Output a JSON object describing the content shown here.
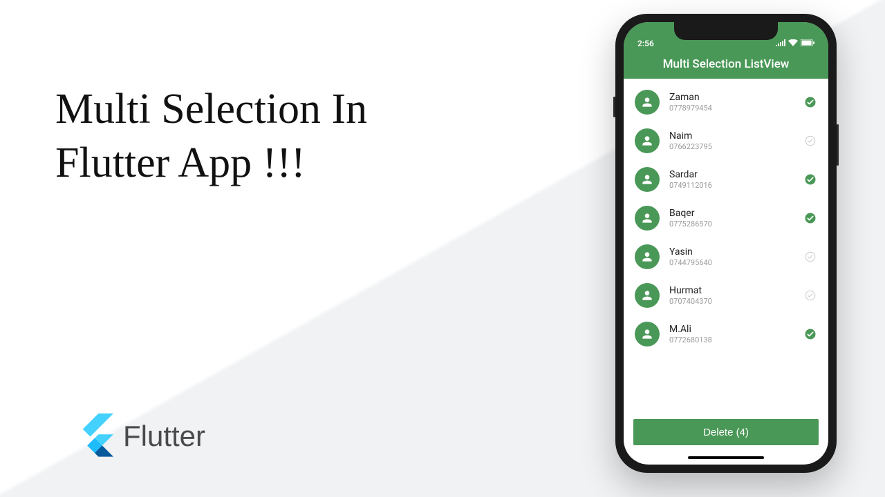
{
  "headline": "Multi Selection In\nFlutter App !!!",
  "brand": "Flutter",
  "statusBar": {
    "time": "2:56"
  },
  "appBar": {
    "title": "Multi Selection ListView"
  },
  "contacts": [
    {
      "name": "Zaman",
      "phone": "0778979454",
      "selected": true
    },
    {
      "name": "Naim",
      "phone": "0766223795",
      "selected": false
    },
    {
      "name": "Sardar",
      "phone": "0749112016",
      "selected": true
    },
    {
      "name": "Baqer",
      "phone": "0775286570",
      "selected": true
    },
    {
      "name": "Yasin",
      "phone": "0744795640",
      "selected": false
    },
    {
      "name": "Hurmat",
      "phone": "0707404370",
      "selected": false
    },
    {
      "name": "M.Ali",
      "phone": "0772680138",
      "selected": true
    }
  ],
  "deleteButton": {
    "label": "Delete (4)"
  },
  "colors": {
    "accent": "#4a9857"
  }
}
